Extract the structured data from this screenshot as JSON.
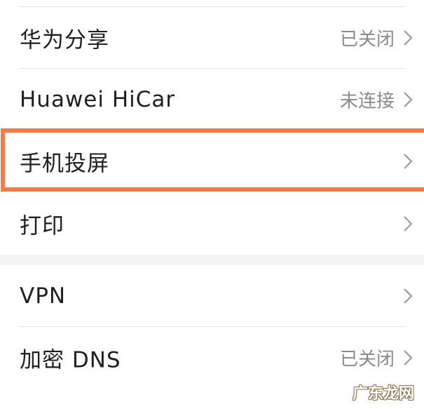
{
  "settings": {
    "group1": [
      {
        "label": "华为分享",
        "status": "已关闭"
      },
      {
        "label": "Huawei HiCar",
        "status": "未连接"
      },
      {
        "label": "手机投屏",
        "status": ""
      },
      {
        "label": "打印",
        "status": ""
      }
    ],
    "group2": [
      {
        "label": "VPN",
        "status": ""
      },
      {
        "label": "加密 DNS",
        "status": "已关闭"
      }
    ]
  },
  "highlight_color": "#f47a4a",
  "watermark": "广东龙网",
  "icons": {
    "row_chevron": "chevron-right-icon"
  }
}
